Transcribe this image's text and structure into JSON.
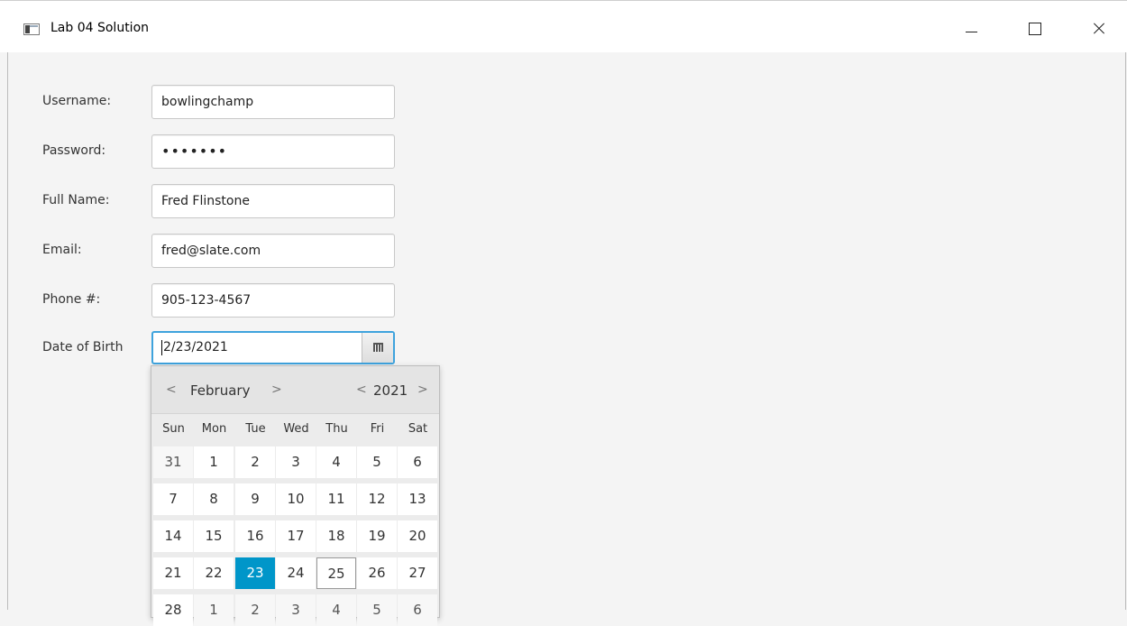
{
  "window": {
    "title": "Lab 04 Solution",
    "controls": {
      "minimize": "minimize",
      "maximize": "maximize",
      "close": "close"
    }
  },
  "form": {
    "username_label": "Username:",
    "username_value": "bowlingchamp",
    "password_label": "Password:",
    "password_mask": "•••••••",
    "fullname_label": "Full Name:",
    "fullname_value": "Fred Flinstone",
    "email_label": "Email:",
    "email_value": "fred@slate.com",
    "phone_label": "Phone #:",
    "phone_value": "905-123-4567",
    "dob_label": "Date of Birth",
    "dob_value": "2/23/2021"
  },
  "calendar": {
    "month": "February",
    "year": "2021",
    "prev": "<",
    "next": ">",
    "weekdays": [
      "Sun",
      "Mon",
      "Tue",
      "Wed",
      "Thu",
      "Fri",
      "Sat"
    ],
    "weeks": [
      [
        "31",
        "1",
        "2",
        "3",
        "4",
        "5",
        "6"
      ],
      [
        "7",
        "8",
        "9",
        "10",
        "11",
        "12",
        "13"
      ],
      [
        "14",
        "15",
        "16",
        "17",
        "18",
        "19",
        "20"
      ],
      [
        "21",
        "22",
        "23",
        "24",
        "25",
        "26",
        "27"
      ],
      [
        "28",
        "1",
        "2",
        "3",
        "4",
        "5",
        "6"
      ]
    ],
    "selected_day": "23",
    "today_day": "25"
  },
  "colors": {
    "accent": "#0096c9",
    "focus_border": "#3ea3dd"
  }
}
